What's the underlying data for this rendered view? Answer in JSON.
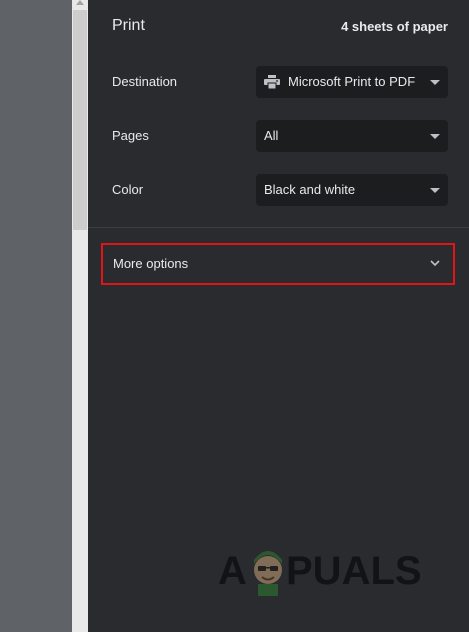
{
  "panel": {
    "title": "Print",
    "sheet_count": "4 sheets of paper"
  },
  "settings": {
    "destination": {
      "label": "Destination",
      "value": "Microsoft Print to PDF",
      "icon": "printer-icon"
    },
    "pages": {
      "label": "Pages",
      "value": "All"
    },
    "color": {
      "label": "Color",
      "value": "Black and white"
    }
  },
  "more_options": {
    "label": "More options",
    "icon": "chevron-down-icon",
    "highlight_color": "#e1141a"
  },
  "watermark": {
    "text": "APPUALS"
  },
  "colors": {
    "panel_background": "#2a2b2e",
    "select_background": "#1c1d1f",
    "preview_background": "#5f6368",
    "text": "#e8eaed"
  }
}
